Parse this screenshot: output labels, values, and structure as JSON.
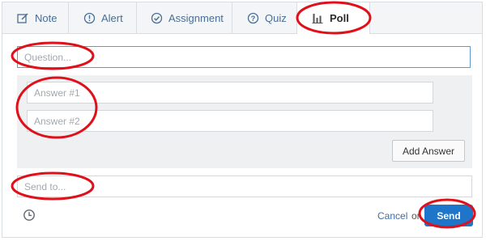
{
  "tabs": [
    {
      "label": "Note",
      "icon": "note-edit-icon"
    },
    {
      "label": "Alert",
      "icon": "alert-icon"
    },
    {
      "label": "Assignment",
      "icon": "assignment-check-icon"
    },
    {
      "label": "Quiz",
      "icon": "quiz-question-icon"
    },
    {
      "label": "Poll",
      "icon": "poll-bars-icon",
      "active": true
    }
  ],
  "form": {
    "question_placeholder": "Question...",
    "answers": [
      {
        "placeholder": "Answer #1"
      },
      {
        "placeholder": "Answer #2"
      }
    ],
    "add_answer_label": "Add Answer",
    "send_to_placeholder": "Send to...",
    "cancel_label": "Cancel",
    "or_label": "or",
    "send_label": "Send"
  },
  "colors": {
    "accent": "#1f75c9",
    "link": "#4a6e94",
    "annotation": "#e0101a"
  }
}
